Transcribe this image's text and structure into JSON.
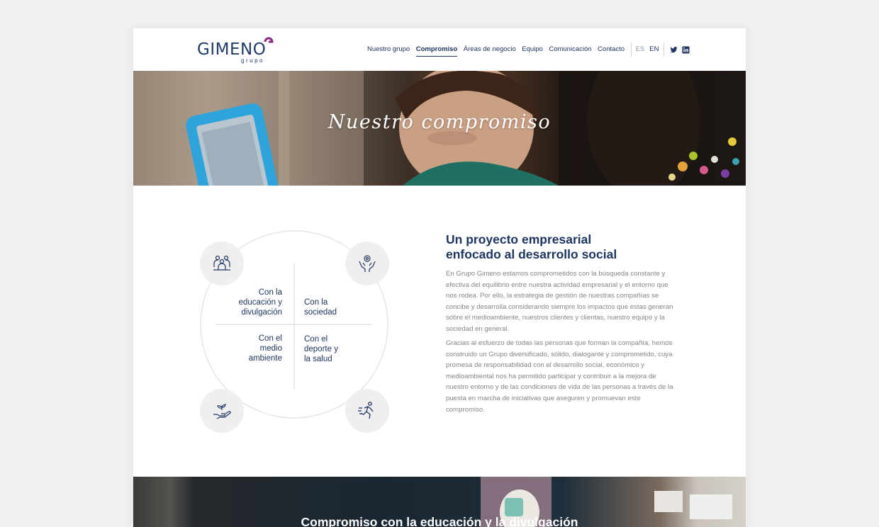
{
  "header": {
    "logo_text": "GIMENO",
    "logo_sub": "grupo",
    "nav": [
      {
        "label": "Nuestro grupo"
      },
      {
        "label": "Compromiso"
      },
      {
        "label": "Áreas de negocio"
      },
      {
        "label": "Equipo"
      },
      {
        "label": "Comunicación"
      },
      {
        "label": "Contacto"
      }
    ],
    "active_nav": "Compromiso",
    "languages": [
      "ES",
      "EN"
    ],
    "social_icons": [
      "twitter-icon",
      "linkedin-icon"
    ]
  },
  "hero": {
    "title": "Nuestro compromiso"
  },
  "diagram": {
    "quadrants": [
      {
        "label": "Con la\neducación y\ndivulgación",
        "icon": "people-group-icon"
      },
      {
        "label": "Con la\nsociedad",
        "icon": "hands-heart-icon"
      },
      {
        "label": "Con el\nmedio\nambiente",
        "icon": "hand-plant-icon"
      },
      {
        "label": "Con el\ndeporte y\nla salud",
        "icon": "runner-icon"
      }
    ]
  },
  "content": {
    "heading_line1": "Un proyecto empresarial",
    "heading_line2": "enfocado al desarrollo social",
    "paragraph1": "En Grupo Gimeno estamos comprometidos con la búsqueda constante y efectiva del equilibrio entre nuestra actividad empresarial y el entorno que nos rodea. Por ello, la estrategia de gestión de nuestras compañías se concibe y desarrolla considerando siempre los impactos que estas generan sobre el medioambiente, nuestros clientes y clientas, nuestro equipo y la sociedad en general.",
    "paragraph2": "Gracias al esfuerzo de todas las personas que forman la compañía, hemos construido un Grupo diversificado, sólido, dialogante y comprometido, cuya promesa de responsabilidad con el desarrollo social, económico y medioambiental nos ha permitido participar y contribuir a la mejora de nuestro entorno y de las condiciones de vida de las personas a través de la puesta en marcha de iniciativas que aseguren y promuevan este compromiso."
  },
  "section2": {
    "title": "Compromiso con la educación y la divulgación"
  },
  "colors": {
    "brand_navy": "#1f3560",
    "brand_purple": "#8a2a7a",
    "text_gray": "#858585",
    "bubble_gray": "#efefef"
  }
}
